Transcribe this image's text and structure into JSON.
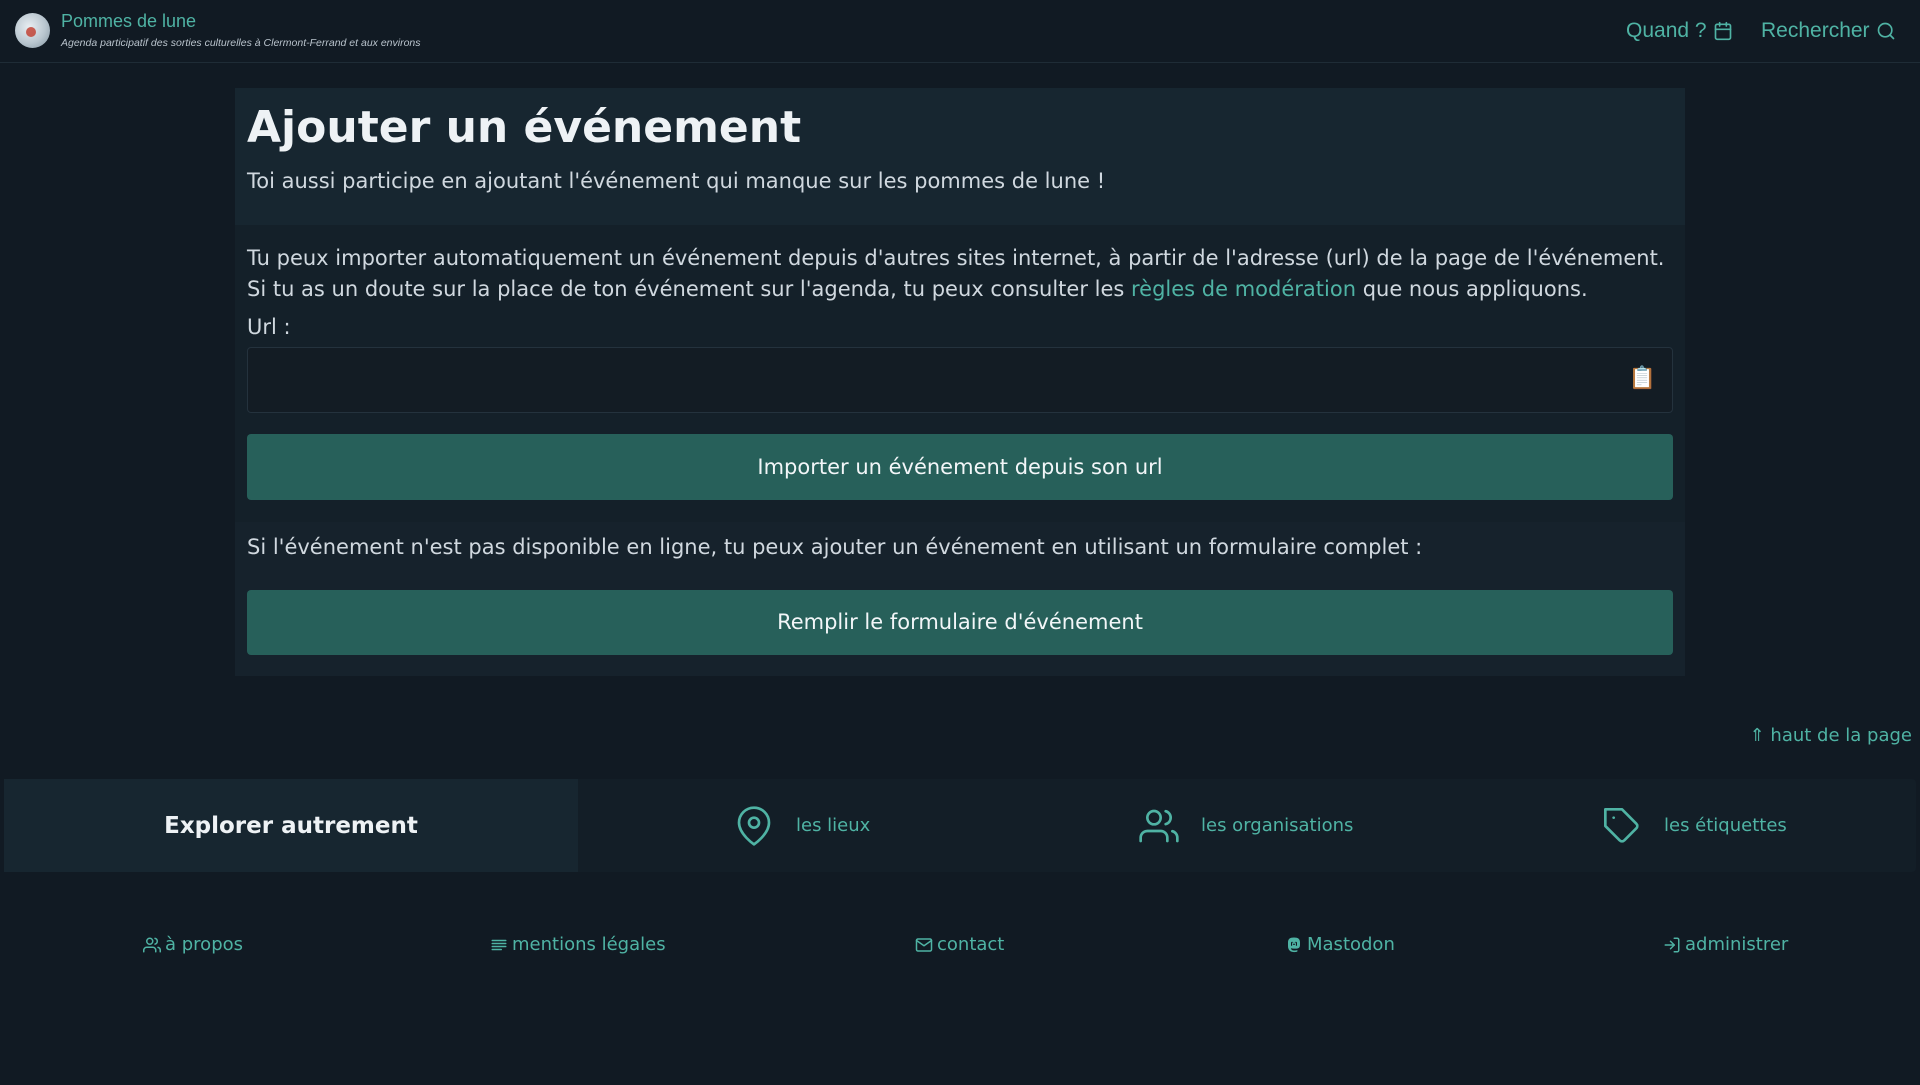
{
  "header": {
    "site_title": "Pommes de lune",
    "site_subtitle": "Agenda participatif des sorties culturelles à Clermont-Ferrand et aux environs",
    "nav_when": "Quand ?",
    "nav_search": "Rechercher"
  },
  "main": {
    "title": "Ajouter un événement",
    "lead": "Toi aussi participe en ajoutant l'événement qui manque sur les pommes de lune !",
    "import_intro_before": "Tu peux importer automatiquement un événement depuis d'autres sites internet, à partir de l'adresse (url) de la page de l'événement. Si tu as un doute sur la place de ton événement sur l'agenda, tu peux consulter les ",
    "import_intro_link": "règles de modération",
    "import_intro_after": " que nous appliquons.",
    "url_label": "Url :",
    "url_value": "",
    "paste_icon": "📋",
    "import_button": "Importer un événement depuis son url",
    "form_intro": "Si l'événement n'est pas disponible en ligne, tu peux ajouter un événement en utilisant un formulaire complet :",
    "form_button": "Remplir le formulaire d'événement"
  },
  "top_link": "⇑ haut de la page",
  "explore": {
    "title": "Explorer autrement",
    "places": "les lieux",
    "organisations": "les organisations",
    "tags": "les étiquettes"
  },
  "footer": {
    "about": "à propos",
    "legal": "mentions légales",
    "contact": "contact",
    "mastodon": "Mastodon",
    "admin": "administrer"
  },
  "colors": {
    "accent": "#4fb3a4",
    "button": "#27605a",
    "background": "#111a23"
  }
}
